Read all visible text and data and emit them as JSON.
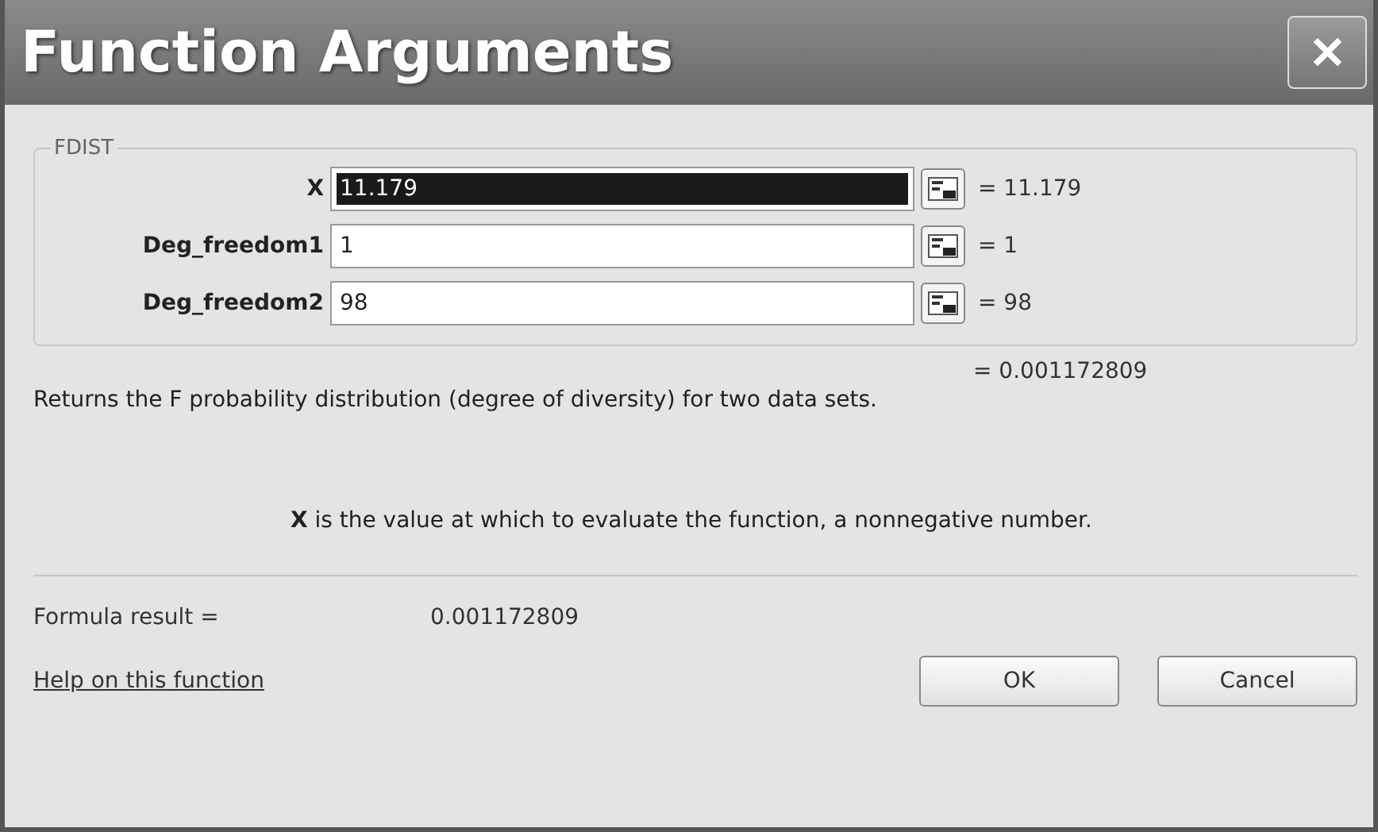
{
  "window": {
    "title": "Function Arguments",
    "close": "✕"
  },
  "function": {
    "name": "FDIST",
    "arguments": [
      {
        "label": "X",
        "value": "11.179",
        "result": "= 11.179",
        "selected": true
      },
      {
        "label": "Deg_freedom1",
        "value": "1",
        "result": "= 1",
        "selected": false
      },
      {
        "label": "Deg_freedom2",
        "value": "98",
        "result": "= 98",
        "selected": false
      }
    ],
    "result": "= 0.001172809"
  },
  "description": "Returns the F probability distribution (degree of diversity) for two data sets.",
  "argument_help": "**X** is the value at which to evaluate the function, a nonnegative number.",
  "formula_result": {
    "label": "Formula result =",
    "value": "0.001172809"
  },
  "help_link": "Help on this function",
  "buttons": [
    "OK",
    "Cancel"
  ]
}
